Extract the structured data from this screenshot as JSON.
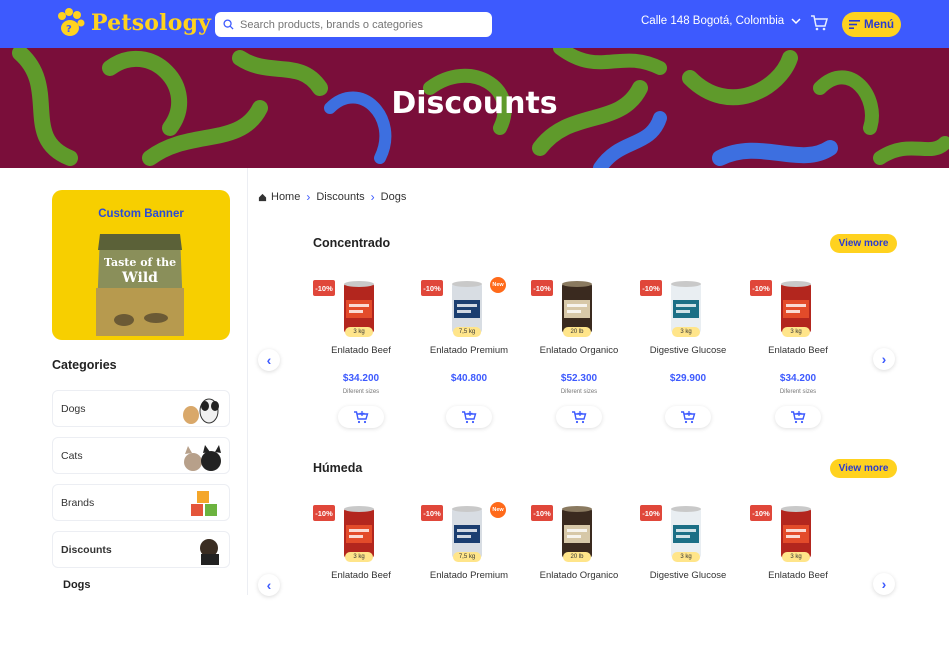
{
  "header": {
    "brand": "Petsology",
    "search_placeholder": "Search products, brands o categories",
    "location": "Calle 148 Bogotá, Colombia",
    "menu_label": "Menú"
  },
  "banner": {
    "title": "Discounts"
  },
  "sidebar": {
    "custom_banner_title": "Custom Banner",
    "custom_banner_product": "Taste of the Wild",
    "categories_title": "Categories",
    "categories": [
      {
        "label": "Dogs"
      },
      {
        "label": "Cats"
      },
      {
        "label": "Brands"
      },
      {
        "label": "Discounts"
      }
    ],
    "subcategory": "Dogs"
  },
  "breadcrumb": [
    "Home",
    "Discounts",
    "Dogs"
  ],
  "sections": [
    {
      "title": "Concentrado",
      "view_more": "View more",
      "products": [
        {
          "discount": "-10%",
          "name": "Enlatado Beef",
          "size": "3 kg",
          "price": "$34.200",
          "note": "Diferent sizes",
          "badge": ""
        },
        {
          "discount": "-10%",
          "name": "Enlatado Premium",
          "size": "7,5 kg",
          "price": "$40.800",
          "note": "",
          "badge": "New"
        },
        {
          "discount": "-10%",
          "name": "Enlatado Organico",
          "size": "20 lb",
          "price": "$52.300",
          "note": "Diferent sizes",
          "badge": ""
        },
        {
          "discount": "-10%",
          "name": "Digestive Glucose",
          "size": "3 kg",
          "price": "$29.900",
          "note": "",
          "badge": ""
        },
        {
          "discount": "-10%",
          "name": "Enlatado Beef",
          "size": "3 kg",
          "price": "$34.200",
          "note": "Diferent sizes",
          "badge": ""
        }
      ]
    },
    {
      "title": "Húmeda",
      "view_more": "View more",
      "products": [
        {
          "discount": "-10%",
          "name": "Enlatado Beef",
          "size": "3 kg",
          "badge": ""
        },
        {
          "discount": "-10%",
          "name": "Enlatado Premium",
          "size": "7,5 kg",
          "badge": "New"
        },
        {
          "discount": "-10%",
          "name": "Enlatado Organico",
          "size": "20 lb",
          "badge": ""
        },
        {
          "discount": "-10%",
          "name": "Digestive Glucose",
          "size": "3 kg",
          "badge": ""
        },
        {
          "discount": "-10%",
          "name": "Enlatado Beef",
          "size": "3 kg",
          "badge": ""
        }
      ]
    }
  ],
  "colors": {
    "primary": "#3d5afe",
    "accent": "#ffd21f",
    "banner_bg": "#7a0e3a",
    "discount": "#e0473a"
  }
}
